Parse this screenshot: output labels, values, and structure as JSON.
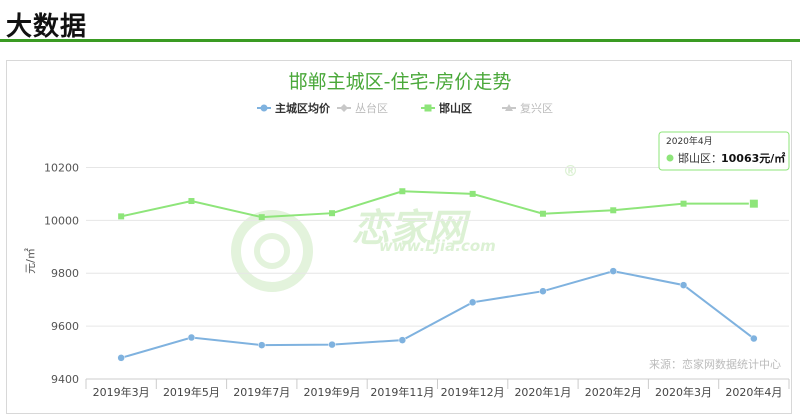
{
  "section": {
    "title": "大数据"
  },
  "watermark": {
    "brand": "恋家网",
    "url": "www.Ljia.com",
    "reg": "®"
  },
  "source": "来源：恋家网数据统计中心",
  "tooltip": {
    "date": "2020年4月",
    "label": "邯山区：",
    "value": "10063元/㎡"
  },
  "colors": {
    "accent": "#3a9b23",
    "series_main": "#7fb2df",
    "series_handan": "#8ee57a",
    "muted": "#c8c8c8"
  },
  "chart_data": {
    "type": "line",
    "title": "邯郸主城区-住宅-房价走势",
    "ylabel": "元/㎡",
    "xlabel": "",
    "categories": [
      "2019年3月",
      "2019年5月",
      "2019年7月",
      "2019年9月",
      "2019年11月",
      "2019年12月",
      "2020年1月",
      "2020年2月",
      "2020年3月",
      "2020年4月"
    ],
    "ylim": [
      9400,
      10300
    ],
    "yticks": [
      "9400",
      "9600",
      "9800",
      "10000",
      "10200"
    ],
    "grid": true,
    "legend_position": "top-center",
    "series": [
      {
        "name": "主城区均价",
        "marker": "circle",
        "visible": true,
        "values": [
          9480,
          9557,
          9528,
          9530,
          9547,
          9690,
          9732,
          9808,
          9755,
          9553
        ]
      },
      {
        "name": "丛台区",
        "marker": "diamond",
        "visible": false,
        "values": []
      },
      {
        "name": "邯山区",
        "marker": "square",
        "visible": true,
        "values": [
          10015,
          10073,
          10012,
          10027,
          10110,
          10100,
          10025,
          10038,
          10063,
          10063
        ]
      },
      {
        "name": "复兴区",
        "marker": "triangle",
        "visible": false,
        "values": []
      }
    ]
  }
}
